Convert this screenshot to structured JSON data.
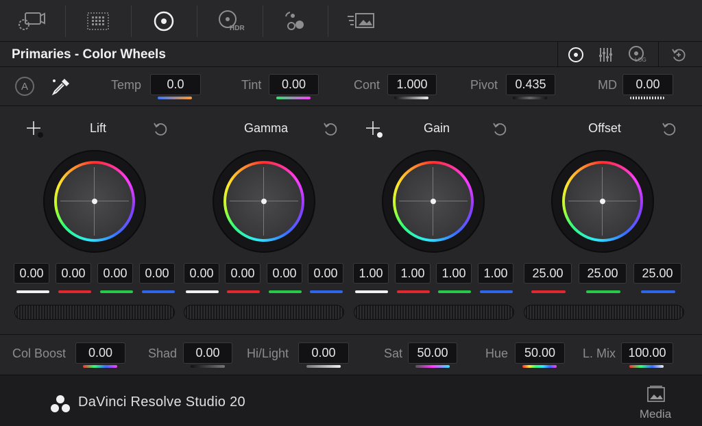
{
  "toolbar": {
    "icons": [
      "camera-raw-icon",
      "color-match-icon",
      "color-wheels-icon",
      "hdr-icon",
      "rgb-mixer-icon",
      "motion-effects-icon"
    ],
    "hdr_label": "HDR"
  },
  "header": {
    "title": "Primaries - Color Wheels",
    "log_label": "LOG"
  },
  "adjust": {
    "auto_label": "A",
    "temp": {
      "label": "Temp",
      "value": "0.0"
    },
    "tint": {
      "label": "Tint",
      "value": "0.00"
    },
    "cont": {
      "label": "Cont",
      "value": "1.000"
    },
    "pivot": {
      "label": "Pivot",
      "value": "0.435"
    },
    "md": {
      "label": "MD",
      "value": "0.00"
    }
  },
  "wheels": [
    {
      "title": "Lift",
      "values": [
        "0.00",
        "0.00",
        "0.00",
        "0.00"
      ]
    },
    {
      "title": "Gamma",
      "values": [
        "0.00",
        "0.00",
        "0.00",
        "0.00"
      ]
    },
    {
      "title": "Gain",
      "values": [
        "1.00",
        "1.00",
        "1.00",
        "1.00"
      ]
    },
    {
      "title": "Offset",
      "values": [
        "25.00",
        "25.00",
        "25.00"
      ]
    }
  ],
  "bottom": {
    "col_boost": {
      "label": "Col Boost",
      "value": "0.00"
    },
    "shad": {
      "label": "Shad",
      "value": "0.00"
    },
    "hilight": {
      "label": "Hi/Light",
      "value": "0.00"
    },
    "sat": {
      "label": "Sat",
      "value": "50.00"
    },
    "hue": {
      "label": "Hue",
      "value": "50.00"
    },
    "lmix": {
      "label": "L. Mix",
      "value": "100.00"
    }
  },
  "footer": {
    "brand": "DaVinci Resolve Studio 20",
    "media_label": "Media"
  },
  "colors": {
    "white": "#f0f0f0",
    "red": "#e0282e",
    "green": "#28c84a",
    "blue": "#2f66e8"
  }
}
